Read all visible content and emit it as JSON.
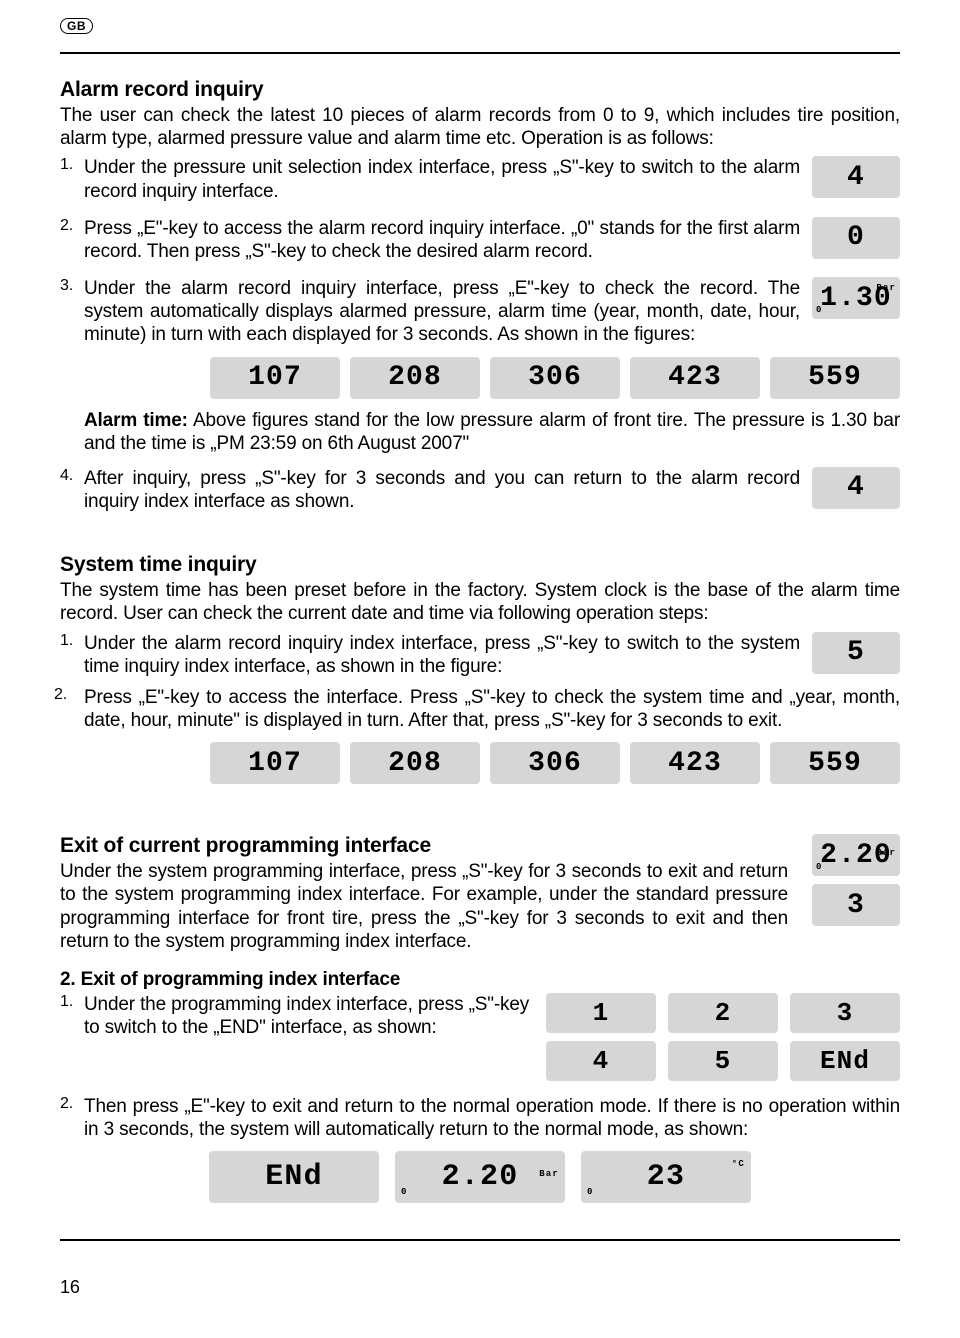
{
  "header": {
    "lang_badge": "GB"
  },
  "alarm_record": {
    "title": "Alarm record inquiry",
    "intro": "The user can check the latest 10 pieces of alarm records from 0 to 9, which includes tire position, alarm type, alarmed pressure value and alarm time etc. Operation is as follows:",
    "steps": {
      "n1": "1.",
      "s1": "Under the pressure unit selection index interface, press „S\"-key to switch to the alarm record inquiry interface.",
      "n2": "2.",
      "s2": "Press „E\"-key to access the alarm record inquiry interface. „0\" stands for the first alarm record. Then press „S\"-key to check the desired alarm record.",
      "n3": "3.",
      "s3": "Under the alarm record inquiry interface, press „E\"-key to check the record. The system automatically displays alarmed pressure, alarm time (year, month, date, hour, minute) in turn with each displayed for 3 seconds. As shown in the figures:",
      "n4": "4.",
      "s4": "After inquiry, press „S\"-key for 3 seconds and you can return to the alarm record inquiry index interface as shown."
    },
    "side_lcd": {
      "d1": "4",
      "d2": "0",
      "d3_prefix": "0",
      "d3": "1.30",
      "d3_unit": "Bar",
      "d4": "4"
    },
    "row_lcd": [
      "107",
      "208",
      "306",
      "423",
      "559"
    ],
    "alarm_time_label": "Alarm time:",
    "alarm_time_text": " Above figures stand for the low pressure alarm of front tire. The pressure is 1.30 bar and the time is „PM 23:59 on 6th August 2007\""
  },
  "system_time": {
    "title": "System time inquiry",
    "intro": "The system time has been preset before in the factory. System clock is the base of the alarm time record. User can check the current date and time via following operation steps:",
    "steps": {
      "n1": "1.",
      "s1": "Under the alarm record inquiry index interface, press „S\"-key to switch to the system time inquiry index interface, as shown in the figure:",
      "n2": "2.",
      "s2": "Press „E\"-key to access the interface. Press „S\"-key to check the system time and „year, month, date, hour, minute\" is displayed in turn. After that, press „S\"-key for 3 seconds to exit."
    },
    "side_lcd": "5",
    "row_lcd": [
      "107",
      "208",
      "306",
      "423",
      "559"
    ]
  },
  "exit": {
    "title": "Exit of current programming interface",
    "intro": "Under the system programming interface, press „S\"-key for 3 seconds to exit and return to the system programming index interface. For example, under the standard pressure programming interface for front tire, press the „S\"-key for 3 seconds to exit and then return to the system programming index interface.",
    "side_lcd_top_prefix": "0",
    "side_lcd_top": "2.20",
    "side_lcd_top_unit": "Bar",
    "side_lcd_bottom": "3",
    "sub2_title": "2.  Exit of programming index interface",
    "sub2_n1": "1.",
    "sub2_s1": "Under the programming index interface, press „S\"-key to switch to the „END\" interface, as shown:",
    "grid": [
      "1",
      "2",
      "3",
      "4",
      "5",
      "ENd"
    ],
    "sub2_n2": "2.",
    "sub2_s2": "Then press „E\"-key to exit and return to the normal operation mode. If there is no operation within in 3 seconds, the system will automatically return to the normal mode, as shown:",
    "final": {
      "c1": "ENd",
      "c2_prefix": "0",
      "c2": "2.20",
      "c2_unit": "Bar",
      "c3_prefix": "0",
      "c3": "23",
      "c3_unit": "°C"
    }
  },
  "page_number": "16"
}
